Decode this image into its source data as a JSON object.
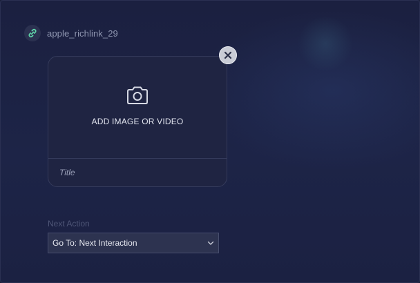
{
  "header": {
    "title": "apple_richlink_29",
    "icon": "link-icon"
  },
  "card": {
    "media_label": "ADD IMAGE OR VIDEO",
    "media_icon": "camera-icon",
    "title_placeholder": "Title",
    "close_icon": "close-icon"
  },
  "next_action": {
    "label": "Next Action",
    "selected": "Go To: Next Interaction",
    "dropdown_icon": "chevron-down-icon"
  },
  "colors": {
    "background": "#1b2040",
    "link_icon": "#5fd3a8",
    "card_border": "#353b5c"
  }
}
